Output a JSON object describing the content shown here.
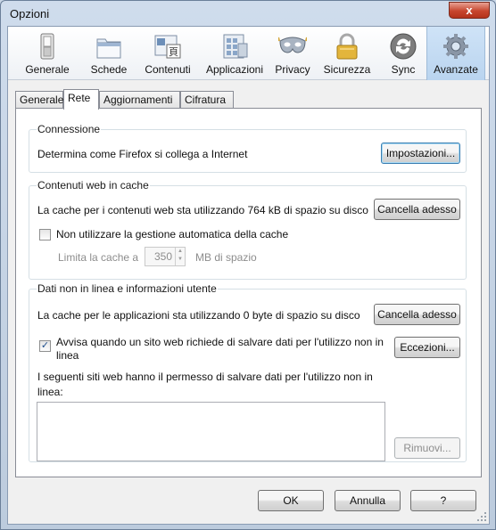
{
  "window": {
    "title": "Opzioni",
    "close_label": "x"
  },
  "toolbar": [
    {
      "label": "Generale",
      "icon": "switch-icon"
    },
    {
      "label": "Schede",
      "icon": "tabs-icon"
    },
    {
      "label": "Contenuti",
      "icon": "content-icon"
    },
    {
      "label": "Applicazioni",
      "icon": "applications-icon"
    },
    {
      "label": "Privacy",
      "icon": "mask-icon"
    },
    {
      "label": "Sicurezza",
      "icon": "lock-icon"
    },
    {
      "label": "Sync",
      "icon": "sync-icon"
    },
    {
      "label": "Avanzate",
      "icon": "gear-icon",
      "selected": true
    }
  ],
  "tabs": [
    {
      "label": "Generale"
    },
    {
      "label": "Rete",
      "active": true
    },
    {
      "label": "Aggiornamenti"
    },
    {
      "label": "Cifratura"
    }
  ],
  "connection": {
    "title": "Connessione",
    "description": "Determina come Firefox si collega a Internet",
    "settings_button": "Impostazioni..."
  },
  "web_cache": {
    "title": "Contenuti web in cache",
    "usage_text": "La cache per i contenuti web sta utilizzando 764 kB di spazio su disco",
    "clear_button": "Cancella adesso",
    "override_checkbox": "Non utilizzare la gestione automatica della cache",
    "override_checked": false,
    "limit_label": "Limita la cache a",
    "limit_value": "350",
    "limit_unit": "MB di spazio"
  },
  "offline": {
    "title": "Dati non in linea e informazioni utente",
    "usage_text": "La cache per le applicazioni sta utilizzando 0 byte di spazio su disco",
    "clear_button": "Cancella adesso",
    "notify_checkbox_line1": "Avvisa quando un sito web richiede di salvare dati per l'utilizzo non in",
    "notify_checkbox_line2": "linea",
    "notify_checked": true,
    "exceptions_button": "Eccezioni...",
    "allowed_line1": "I seguenti siti web hanno il permesso di salvare dati per l'utilizzo non in",
    "allowed_line2": "linea:",
    "remove_button": "Rimuovi..."
  },
  "footer": {
    "ok": "OK",
    "cancel": "Annulla",
    "help": "?"
  },
  "colors": {
    "selected_toolbar": "#b9d4ef",
    "focus_border": "#3c7fb1",
    "close_red": "#c7462e"
  }
}
